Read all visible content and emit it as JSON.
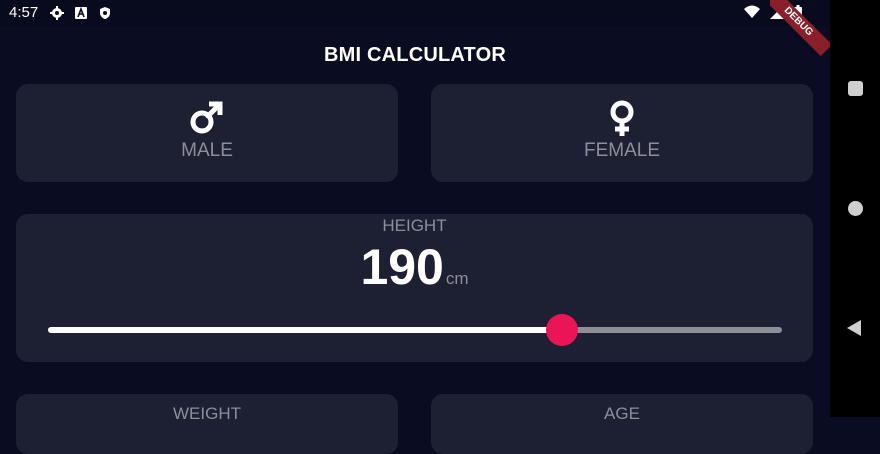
{
  "status_bar": {
    "time": "4:57",
    "left_icons": [
      "gear-icon",
      "a-icon",
      "shield-icon"
    ],
    "right_icons": [
      "wifi-icon",
      "cellular-icon",
      "battery-icon"
    ]
  },
  "app_bar": {
    "title": "BMI CALCULATOR",
    "debug_ribbon": "DEBUG"
  },
  "gender_cards": [
    {
      "label": "MALE",
      "icon": "male-symbol-icon"
    },
    {
      "label": "FEMALE",
      "icon": "female-symbol-icon"
    }
  ],
  "height_card": {
    "label": "HEIGHT",
    "value": "190",
    "unit": "cm",
    "slider": {
      "min": 120,
      "max": 220,
      "value": 190
    }
  },
  "bottom_cards": [
    {
      "label": "WEIGHT"
    },
    {
      "label": "AGE"
    }
  ],
  "colors": {
    "background": "#0a0d22",
    "card": "#1d1f33",
    "accent": "#eb1555",
    "label_text": "#8d8e98"
  },
  "nav_bar": {
    "buttons": [
      "recents-square-icon",
      "home-circle-icon",
      "back-triangle-icon"
    ]
  }
}
